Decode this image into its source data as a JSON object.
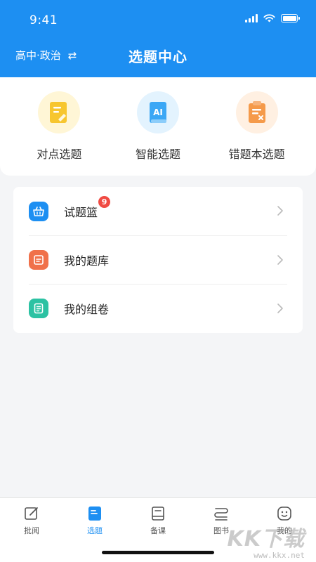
{
  "status_bar": {
    "time": "9:41"
  },
  "header": {
    "subject": "高中·政治",
    "swap_icon": "⇄",
    "title": "选题中心"
  },
  "quick_select": [
    {
      "label": "对点选题",
      "icon": "document-edit-icon",
      "color": "#f7c62f",
      "bg": "#fff6d6"
    },
    {
      "label": "智能选题",
      "icon": "ai-icon",
      "color": "#3ba7f5",
      "bg": "#e3f3fe"
    },
    {
      "label": "错题本选题",
      "icon": "clipboard-x-icon",
      "color": "#f59a4a",
      "bg": "#fff0e2"
    }
  ],
  "menu": [
    {
      "label": "试题篮",
      "badge": "9",
      "icon": "basket-icon",
      "color": "#1d8ff2"
    },
    {
      "label": "我的题库",
      "icon": "folder-icon",
      "color": "#f0714a"
    },
    {
      "label": "我的组卷",
      "icon": "list-doc-icon",
      "color": "#2cc2a3"
    }
  ],
  "tabs": [
    {
      "label": "批阅",
      "icon": "pen-edit-icon",
      "active": false
    },
    {
      "label": "选题",
      "icon": "doc-tab-icon",
      "active": true
    },
    {
      "label": "备课",
      "icon": "book-icon",
      "active": false
    },
    {
      "label": "图书",
      "icon": "books-icon",
      "active": false
    },
    {
      "label": "我的",
      "icon": "smile-icon",
      "active": false
    }
  ],
  "watermark": {
    "logo": "KK下载",
    "url": "www.kkx.net"
  },
  "colors": {
    "primary": "#1d8ff2",
    "badge": "#f04b43"
  }
}
